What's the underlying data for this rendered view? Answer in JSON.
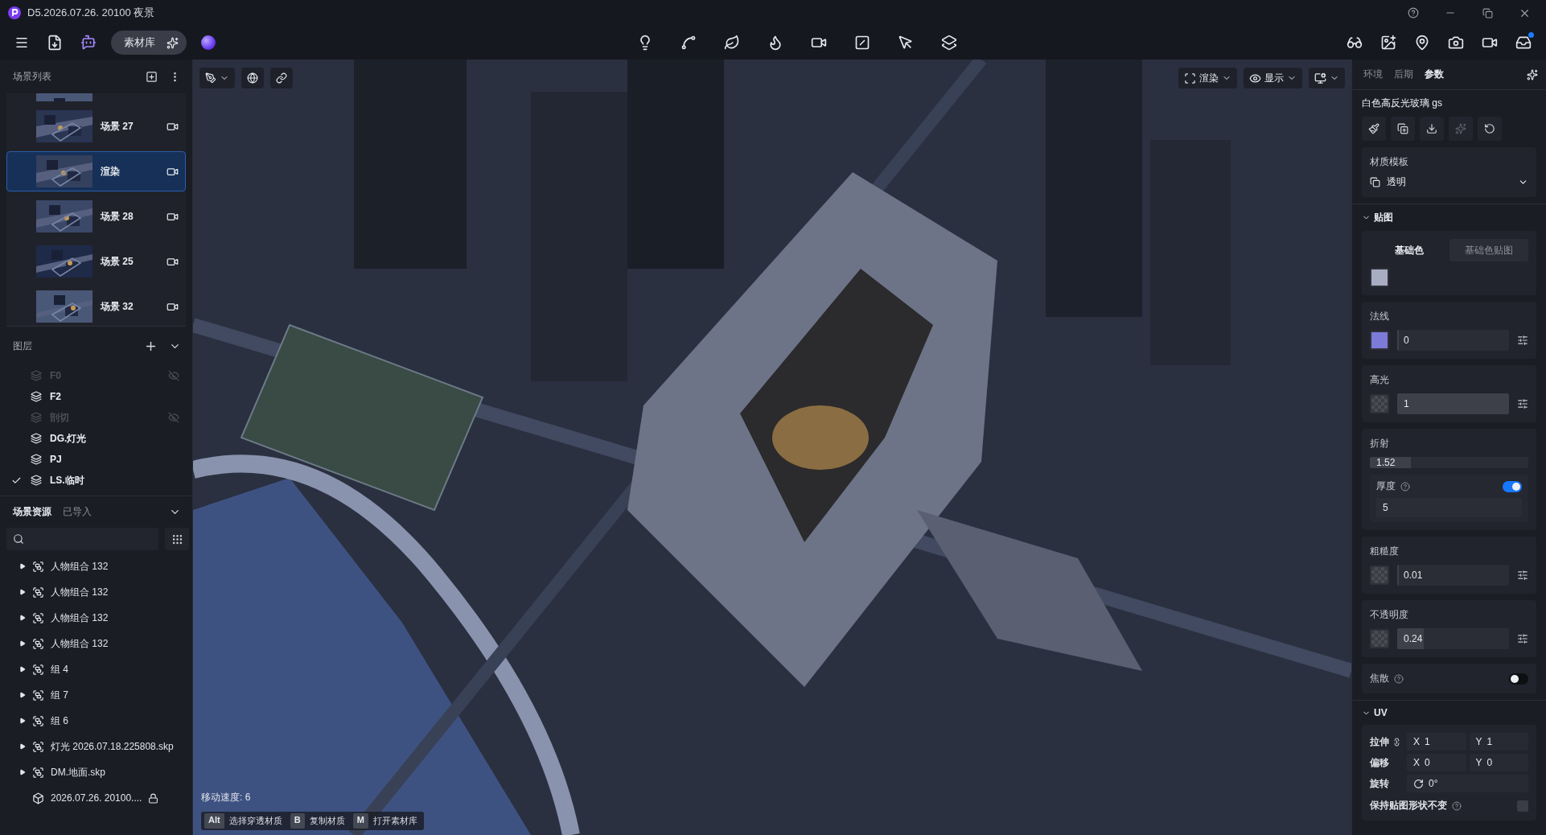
{
  "window": {
    "title": "D5.2026.07.26. 20100 夜景"
  },
  "toolbar": {
    "library_button": "素材库"
  },
  "scene_list": {
    "title": "场景列表",
    "scenes": [
      {
        "name": "场景 27",
        "selected": false
      },
      {
        "name": "渲染",
        "selected": true
      },
      {
        "name": "场景 28",
        "selected": false
      },
      {
        "name": "场景 25",
        "selected": false
      },
      {
        "name": "场景 32",
        "selected": false
      }
    ]
  },
  "layers": {
    "title": "图层",
    "items": [
      {
        "name": "F0",
        "visible": false,
        "checked": false
      },
      {
        "name": "F2",
        "visible": true,
        "checked": false
      },
      {
        "name": "剖切",
        "visible": false,
        "checked": false
      },
      {
        "name": "DG.灯光",
        "visible": true,
        "checked": false
      },
      {
        "name": "PJ",
        "visible": true,
        "checked": false
      },
      {
        "name": "LS.临时",
        "visible": true,
        "checked": true
      }
    ]
  },
  "assets": {
    "tabs": [
      {
        "label": "场景资源",
        "selected": true
      },
      {
        "label": "已导入",
        "selected": false
      }
    ],
    "items": [
      {
        "name": "人物组合 132",
        "kind": "group",
        "locked": false
      },
      {
        "name": "人物组合 132",
        "kind": "group",
        "locked": false
      },
      {
        "name": "人物组合 132",
        "kind": "group",
        "locked": false
      },
      {
        "name": "人物组合 132",
        "kind": "group",
        "locked": false
      },
      {
        "name": "组 4",
        "kind": "group",
        "locked": false
      },
      {
        "name": "组 7",
        "kind": "group",
        "locked": false
      },
      {
        "name": "组 6",
        "kind": "group",
        "locked": false
      },
      {
        "name": "灯光 2026.07.18.225808.skp",
        "kind": "group",
        "locked": false
      },
      {
        "name": "DM.地面.skp",
        "kind": "group",
        "locked": false
      },
      {
        "name": "2026.07.26. 20100....",
        "kind": "model",
        "locked": true
      }
    ]
  },
  "viewport": {
    "render_menu": "渲染",
    "display_menu": "显示",
    "speed": "移动速度: 6",
    "shortcuts": [
      {
        "key": "Alt",
        "action": "选择穿透材质"
      },
      {
        "key": "B",
        "action": "复制材质"
      },
      {
        "key": "M",
        "action": "打开素材库"
      }
    ]
  },
  "panel": {
    "tabs": [
      {
        "label": "环境",
        "selected": false
      },
      {
        "label": "后期",
        "selected": false
      },
      {
        "label": "参数",
        "selected": true
      }
    ],
    "material": "白色高反光玻璃 gs",
    "template": {
      "label": "材质模板",
      "value": "透明"
    },
    "maps": {
      "title": "贴图",
      "tabs": [
        {
          "label": "基础色",
          "selected": true
        },
        {
          "label": "基础色贴图",
          "selected": false
        }
      ],
      "color": "#a8adc1"
    },
    "properties": [
      {
        "kind": "map",
        "label": "法线",
        "color": "#7d7bd8",
        "value": "0",
        "level": 0
      },
      {
        "kind": "map",
        "label": "高光",
        "value": "1",
        "level": 1
      },
      {
        "kind": "number",
        "label": "折射",
        "value": "1.52",
        "level": 0.26,
        "sub": {
          "label": "厚度",
          "on": true,
          "value": "5"
        }
      },
      {
        "kind": "map",
        "label": "粗糙度",
        "value": "0.01",
        "level": 0.01
      },
      {
        "kind": "map",
        "label": "不透明度",
        "value": "0.24",
        "level": 0.24
      },
      {
        "kind": "toggle",
        "label": "焦散",
        "on": false
      }
    ],
    "uv": {
      "title": "UV",
      "rows": [
        {
          "kind": "pair",
          "label": "拉伸",
          "fields": [
            {
              "axis": "X",
              "value": "1"
            },
            {
              "axis": "Y",
              "value": "1"
            }
          ]
        },
        {
          "kind": "pair",
          "label": "偏移",
          "fields": [
            {
              "axis": "X",
              "value": "0"
            },
            {
              "axis": "Y",
              "value": "0"
            }
          ]
        },
        {
          "kind": "angle",
          "label": "旋转",
          "value": "0°"
        }
      ],
      "keep_shape": {
        "label": "保持贴图形状不变",
        "checked": false
      }
    }
  }
}
